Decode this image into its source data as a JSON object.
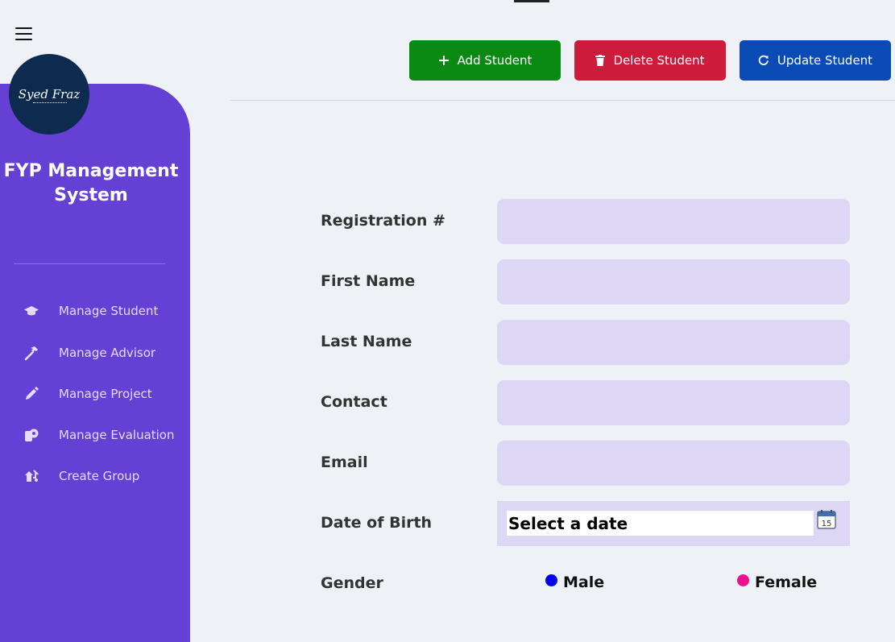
{
  "app": {
    "title": "FYP Management System",
    "logo_text": "Syed Fraz"
  },
  "sidebar": {
    "items": [
      {
        "label": "Manage Student",
        "icon": "graduation-cap-icon"
      },
      {
        "label": "Manage Advisor",
        "icon": "hammer-icon"
      },
      {
        "label": "Manage Project",
        "icon": "pen-icon"
      },
      {
        "label": "Manage Evaluation",
        "icon": "evaluation-icon"
      },
      {
        "label": "Create Group",
        "icon": "group-icon"
      }
    ]
  },
  "toolbar": {
    "add_label": "Add Student",
    "delete_label": "Delete Student",
    "update_label": "Update Student"
  },
  "form": {
    "registration_label": "Registration #",
    "first_name_label": "First Name",
    "last_name_label": "Last Name",
    "contact_label": "Contact",
    "email_label": "Email",
    "dob_label": "Date of Birth",
    "dob_placeholder": "Select a date",
    "gender_label": "Gender",
    "gender_male": "Male",
    "gender_female": "Female",
    "registration_value": "",
    "first_name_value": "",
    "last_name_value": "",
    "contact_value": "",
    "email_value": ""
  },
  "colors": {
    "sidebar": "#6440d4",
    "add_button": "#0a8a12",
    "delete_button": "#cd1c3b",
    "update_button": "#0a4bb5",
    "input_bg": "#ddd7f5",
    "male_dot": "#0000ee",
    "female_dot": "#ee1090"
  }
}
